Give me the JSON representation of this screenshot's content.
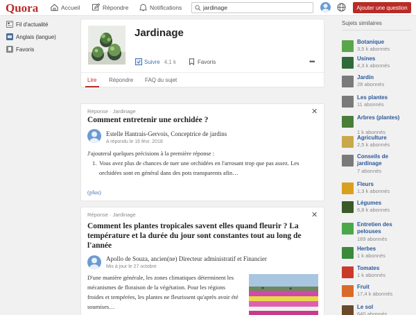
{
  "app": {
    "logo": "Quora"
  },
  "topnav": {
    "home": "Accueil",
    "answer": "Répondre",
    "notifications": "Notifications",
    "search_value": "jardinage",
    "ask_button": "Ajouter une question"
  },
  "leftnav": {
    "items": [
      {
        "label": "Fil d'actualité",
        "icon": "feed-icon"
      },
      {
        "label": "Anglais (langue)",
        "icon": "topic-icon"
      },
      {
        "label": "Favoris",
        "icon": "bookmark-icon"
      }
    ]
  },
  "topic": {
    "title": "Jardinage",
    "follow_label": "Suivre",
    "follow_count": "4,1 k",
    "favorites_label": "Favoris",
    "more": "•••",
    "tabs": [
      "Lire",
      "Répondre",
      "FAQ du sujet"
    ]
  },
  "answers": [
    {
      "meta": "Réponse · Jardinage",
      "question": "Comment entretenir une orchidée ?",
      "author": "Estelle Hantrais-Gervois, Conceptrice de jardins",
      "date": "A répondu le 16 févr. 2018",
      "intro": "J'ajouteral quelques précisions à la première réponse :",
      "list_num": "1.",
      "list_text": "Vous avez plus de chances de tuer une orchidées en l'arrosant trop que pas assez. Les orchidées sont en général dans des pots transparents afin…",
      "more": "(plus)"
    },
    {
      "meta": "Réponse · Jardinage",
      "question": "Comment les plantes tropicales savent elles quand fleurir ? La température et la durée du jour sont constantes tout au long de l'année",
      "author": "Apollo de Souza, ancien(ne) Directeur administratif et Financier",
      "date": "Mis à jour le 27 octobre",
      "body": "D'une manière générale, les zones climatiques déterminent les mécanismes de floraison de la végétation. Pour les régions froides et tempérées, les plantes ne fleurissent qu'après avoir été soumises…"
    }
  ],
  "similar": {
    "title": "Sujets similaires",
    "topics": [
      {
        "name": "Botanique",
        "followers": "3,5 k abonnés",
        "color": "#5aa64a"
      },
      {
        "name": "Usines",
        "followers": "4,3 k abonnés",
        "color": "#2f6b3a"
      },
      {
        "name": "Jardin",
        "followers": "28 abonnés",
        "color": "#7a7a7a"
      },
      {
        "name": "Les plantes",
        "followers": "11 abonnés",
        "color": "#7a7a7a"
      },
      {
        "name": "Arbres (plantes)",
        "followers": "1 k abonnés",
        "color": "#4a7d3a"
      },
      {
        "name": "Agriculture",
        "followers": "2,5 k abonnés",
        "color": "#c9a84a"
      },
      {
        "name": "Conseils de jardinage",
        "followers": "7 abonnés",
        "color": "#7a7a7a"
      },
      {
        "name": "Fleurs",
        "followers": "1,3 k abonnés",
        "color": "#d9a020"
      },
      {
        "name": "Légumes",
        "followers": "6,8 k abonnés",
        "color": "#3a5a2a"
      },
      {
        "name": "Entretien des pelouses",
        "followers": "189 abonnés",
        "color": "#4aa84a"
      },
      {
        "name": "Herbes",
        "followers": "1 k abonnés",
        "color": "#3a8a3a"
      },
      {
        "name": "Tomates",
        "followers": "1 k abonnés",
        "color": "#c93a2a"
      },
      {
        "name": "Fruit",
        "followers": "17,4 k abonnés",
        "color": "#d96a2a"
      },
      {
        "name": "Le sol",
        "followers": "640 abonnés",
        "color": "#6a4a2a"
      }
    ]
  }
}
